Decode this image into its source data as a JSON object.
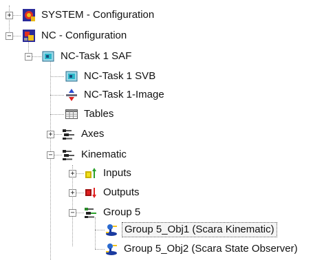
{
  "tree": {
    "system_config": {
      "label": "SYSTEM - Configuration",
      "expander": "+"
    },
    "nc_config": {
      "label": "NC - Configuration",
      "expander": "−"
    },
    "nc_task_saf": {
      "label": "NC-Task 1 SAF",
      "expander": "−"
    },
    "nc_task_svb": {
      "label": "NC-Task 1 SVB"
    },
    "nc_task_image": {
      "label": "NC-Task 1-Image"
    },
    "tables": {
      "label": "Tables"
    },
    "axes": {
      "label": "Axes",
      "expander": "+"
    },
    "kinematic": {
      "label": "Kinematic",
      "expander": "−"
    },
    "inputs": {
      "label": "Inputs",
      "expander": "+"
    },
    "outputs": {
      "label": "Outputs",
      "expander": "+"
    },
    "group5": {
      "label": "Group 5",
      "expander": "−"
    },
    "group5_obj1": {
      "label": "Group 5_Obj1 (Scara Kinematic)",
      "selected": true
    },
    "group5_obj2": {
      "label": "Group 5_Obj2 (Scara State Observer)"
    }
  },
  "colors": {
    "tree_line": "#9a9a9a",
    "selection_border": "#555555"
  }
}
